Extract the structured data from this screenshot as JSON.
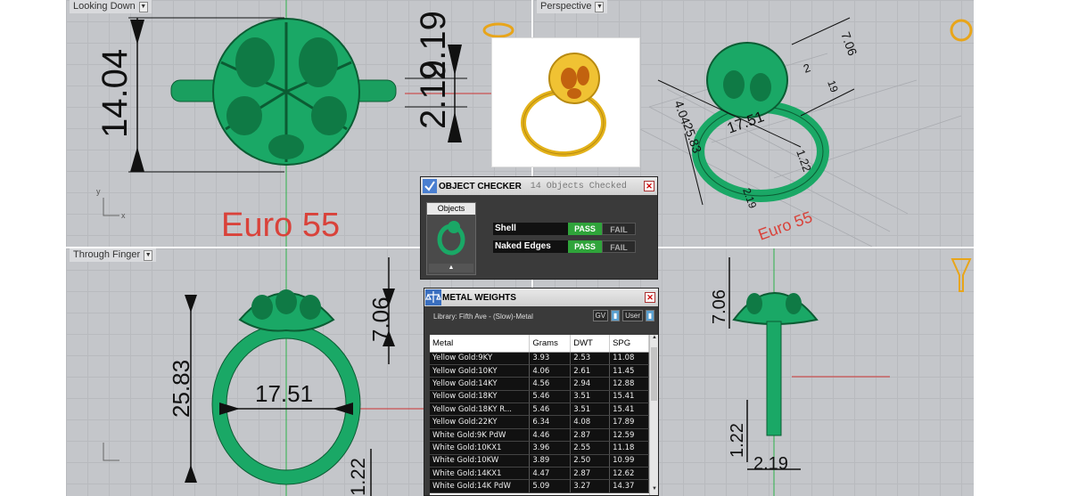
{
  "viewports": {
    "top_left": {
      "title": "Looking Down",
      "dims": [
        "14.04",
        "2.19"
      ],
      "label": "Euro 55"
    },
    "top_right": {
      "title": "Perspective",
      "dims": [
        "7.06",
        "2",
        "19",
        "17.51",
        "1.22",
        "4.04",
        "25.83",
        "2.19"
      ],
      "label": "Euro 55"
    },
    "bottom_left": {
      "title": "Through Finger",
      "dims": [
        "7.06",
        "25.83",
        "17.51",
        "1.22"
      ]
    },
    "bottom_right": {
      "title": "",
      "dims": [
        "7.06",
        "1.22",
        "2.19"
      ]
    }
  },
  "object_checker": {
    "title": "OBJECT CHECKER",
    "subtitle": "14 Objects Checked",
    "objects_tab": "Objects",
    "checks": [
      {
        "label": "Shell",
        "pass": "PASS",
        "fail": "FAIL"
      },
      {
        "label": "Naked Edges",
        "pass": "PASS",
        "fail": "FAIL"
      }
    ]
  },
  "metal_weights": {
    "title": "METAL WEIGHTS",
    "library": "Library: Fifth Ave - (Slow)-Metal",
    "unit_a": "GV",
    "unit_b": "User",
    "columns": [
      "Metal",
      "Grams",
      "DWT",
      "SPG"
    ],
    "rows": [
      [
        "Yellow Gold:9KY",
        "3.93",
        "2.53",
        "11.08"
      ],
      [
        "Yellow Gold:10KY",
        "4.06",
        "2.61",
        "11.45"
      ],
      [
        "Yellow Gold:14KY",
        "4.56",
        "2.94",
        "12.88"
      ],
      [
        "Yellow Gold:18KY",
        "5.46",
        "3.51",
        "15.41"
      ],
      [
        "Yellow Gold:18KY R...",
        "5.46",
        "3.51",
        "15.41"
      ],
      [
        "Yellow Gold:22KY",
        "6.34",
        "4.08",
        "17.89"
      ],
      [
        "White Gold:9K PdW",
        "4.46",
        "2.87",
        "12.59"
      ],
      [
        "White Gold:10KX1",
        "3.96",
        "2.55",
        "11.18"
      ],
      [
        "White Gold:10KW",
        "3.89",
        "2.50",
        "10.99"
      ],
      [
        "White Gold:14KX1",
        "4.47",
        "2.87",
        "12.62"
      ],
      [
        "White Gold:14K PdW",
        "5.09",
        "3.27",
        "14.37"
      ]
    ]
  },
  "colors": {
    "ring_green": "#1aa866",
    "viewport_bg": "#c4c6ca",
    "pass_green": "#2fa43a",
    "euro_red": "#d9423a"
  }
}
